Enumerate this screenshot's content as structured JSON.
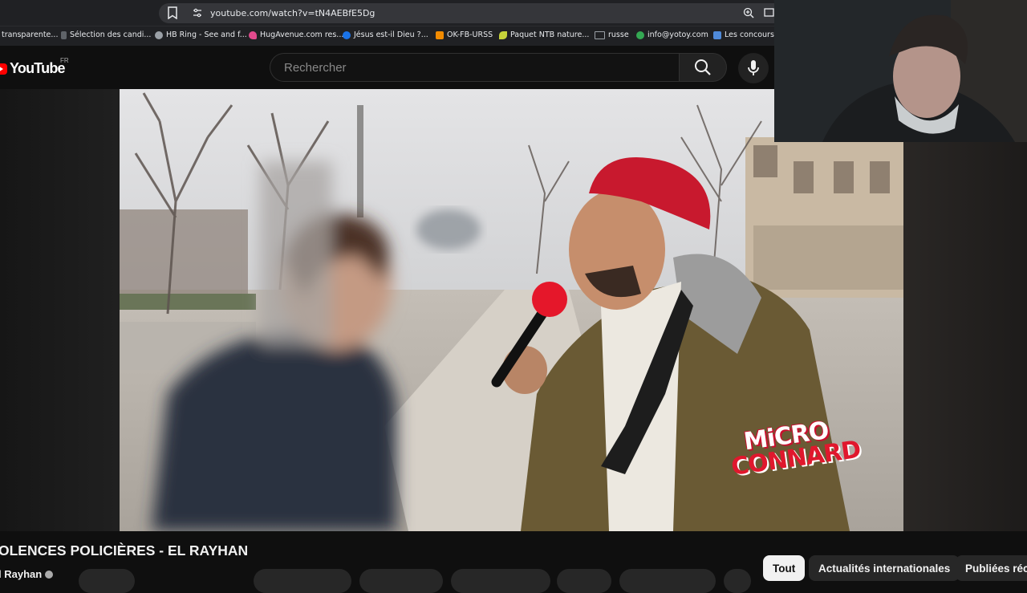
{
  "browser": {
    "url": "youtube.com/watch?v=tN4AEBfE5Dg",
    "bookmarks": [
      {
        "label": "transparente...",
        "color": "#5f6368"
      },
      {
        "label": "Sélection des candi...",
        "color": "#5f6368"
      },
      {
        "label": "HB Ring - See and f...",
        "color": "#9aa0a6"
      },
      {
        "label": "HugAvenue.com res...",
        "color": "#e24a8d"
      },
      {
        "label": "Jésus est-il Dieu ?...",
        "color": "#1a73e8"
      },
      {
        "label": "OK-FB-URSS",
        "color": "#f28b00"
      },
      {
        "label": "Paquet NTB nature...",
        "color": "#c6d33a"
      },
      {
        "label": "russe",
        "color": "#9aa0a6"
      },
      {
        "label": "info@yotoy.com",
        "color": "#34a853"
      },
      {
        "label": "Les concours de",
        "color": "#4f8ad9"
      }
    ]
  },
  "youtube": {
    "logo_text": "YouTube",
    "country_code": "FR",
    "search_placeholder": "Rechercher"
  },
  "video": {
    "overlay_logo_line1": "MiCRO",
    "overlay_logo_line2": "CONNARD",
    "title": "OLENCES POLICIÈRES - EL RAYHAN",
    "channel": "l Rayhan"
  },
  "chips": [
    {
      "label": "Tout",
      "active": true
    },
    {
      "label": "Actualités internationales",
      "active": false
    },
    {
      "label": "Publiées réc",
      "active": false
    }
  ],
  "colors": {
    "brand_red": "#ff0000",
    "background": "#0f0f0f",
    "beanie_red": "#c8192e"
  }
}
